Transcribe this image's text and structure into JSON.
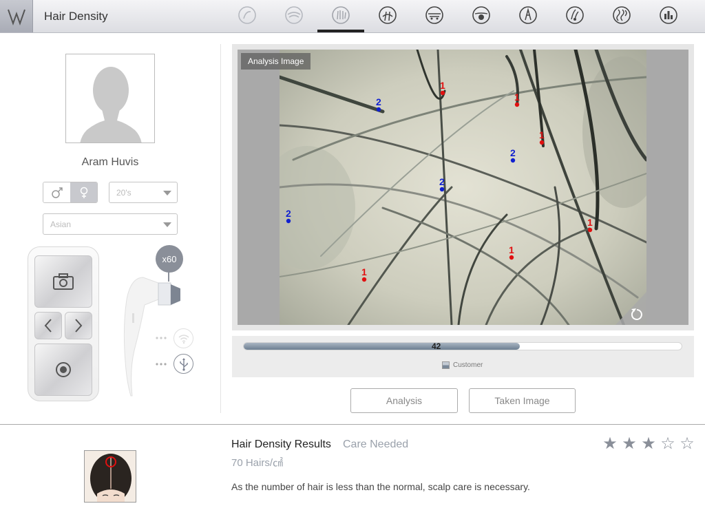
{
  "header": {
    "title": "Hair Density",
    "tabs": [
      {
        "icon": "hair-type-icon",
        "active": false
      },
      {
        "icon": "scalp-icon",
        "active": false
      },
      {
        "icon": "hair-density-icon",
        "active": true
      },
      {
        "icon": "hair-loss-icon",
        "active": false
      },
      {
        "icon": "pore-icon",
        "active": false
      },
      {
        "icon": "sebum-icon",
        "active": false
      },
      {
        "icon": "hair-thickness-icon",
        "active": false
      },
      {
        "icon": "dead-skin-icon",
        "active": false
      },
      {
        "icon": "hair-damage-icon",
        "active": false
      },
      {
        "icon": "report-chart-icon",
        "active": false
      }
    ]
  },
  "profile": {
    "name": "Aram Huvis",
    "gender_selected": "female",
    "age_group": "20's",
    "ethnicity": "Asian"
  },
  "device": {
    "magnification": "x60"
  },
  "analysis": {
    "image_label": "Analysis Image",
    "markers": [
      {
        "label": "1",
        "color": "#e01010"
      },
      {
        "label": "1",
        "color": "#e01010"
      },
      {
        "label": "1",
        "color": "#e01010"
      },
      {
        "label": "1",
        "color": "#e01010"
      },
      {
        "label": "1",
        "color": "#e01010"
      },
      {
        "label": "1",
        "color": "#e01010"
      },
      {
        "label": "2",
        "color": "#1020d0"
      },
      {
        "label": "2",
        "color": "#1020d0"
      },
      {
        "label": "2",
        "color": "#1020d0"
      },
      {
        "label": "2",
        "color": "#1020d0"
      }
    ],
    "bar_value": "42",
    "bar_fraction": 0.42,
    "legend_label": "Customer",
    "analysis_button": "Analysis",
    "taken_image_button": "Taken Image"
  },
  "result": {
    "title": "Hair Density Results",
    "status": "Care Needed",
    "value": "70 Hairs/㎠",
    "description": "As the number of hair is less than the normal, scalp care is necessary.",
    "rating": 3,
    "rating_max": 5
  },
  "colors": {
    "marker_1": "#e01010",
    "marker_2": "#1020d0",
    "accent": "#8a8f99"
  }
}
